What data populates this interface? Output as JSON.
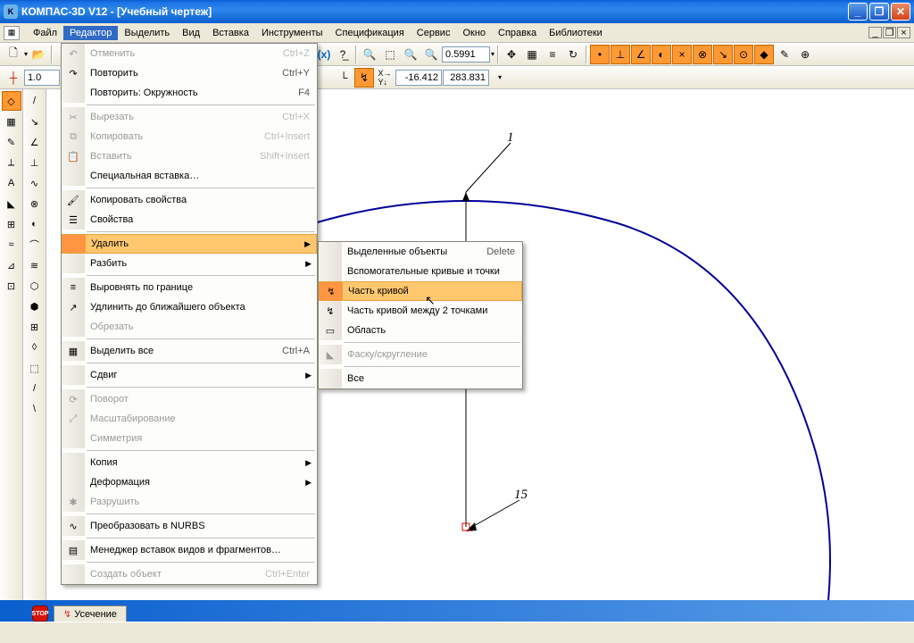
{
  "title": "КОМПАС-3D V12 - [Учебный чертеж]",
  "menubar": [
    "Файл",
    "Редактор",
    "Выделить",
    "Вид",
    "Вставка",
    "Инструменты",
    "Спецификация",
    "Сервис",
    "Окно",
    "Справка",
    "Библиотеки"
  ],
  "active_menu_index": 1,
  "toolbar2_value": "1.0",
  "zoom_value": "0.5991",
  "coord_x": "-16.412",
  "coord_y": "283.831",
  "editor_menu": [
    {
      "t": "item",
      "label": "Отменить",
      "shortcut": "Ctrl+Z",
      "disabled": true,
      "icon": "↶"
    },
    {
      "t": "item",
      "label": "Повторить",
      "shortcut": "Ctrl+Y",
      "icon": "↷"
    },
    {
      "t": "item",
      "label": "Повторить: Окружность",
      "shortcut": "F4"
    },
    {
      "t": "sep"
    },
    {
      "t": "item",
      "label": "Вырезать",
      "shortcut": "Ctrl+X",
      "disabled": true,
      "icon": "✂"
    },
    {
      "t": "item",
      "label": "Копировать",
      "shortcut": "Ctrl+Insert",
      "disabled": true,
      "icon": "⧉"
    },
    {
      "t": "item",
      "label": "Вставить",
      "shortcut": "Shift+Insert",
      "disabled": true,
      "icon": "📋"
    },
    {
      "t": "item",
      "label": "Специальная вставка…"
    },
    {
      "t": "sep"
    },
    {
      "t": "item",
      "label": "Копировать свойства",
      "icon": "🖌"
    },
    {
      "t": "item",
      "label": "Свойства",
      "icon": "☰"
    },
    {
      "t": "sep"
    },
    {
      "t": "item",
      "label": "Удалить",
      "submenu": true,
      "hover": true
    },
    {
      "t": "item",
      "label": "Разбить",
      "submenu": true
    },
    {
      "t": "sep"
    },
    {
      "t": "item",
      "label": "Выровнять по границе",
      "icon": "≡"
    },
    {
      "t": "item",
      "label": "Удлинить до ближайшего объекта",
      "icon": "↗"
    },
    {
      "t": "item",
      "label": "Обрезать",
      "disabled": true
    },
    {
      "t": "sep"
    },
    {
      "t": "item",
      "label": "Выделить все",
      "shortcut": "Ctrl+A",
      "icon": "▦"
    },
    {
      "t": "sep"
    },
    {
      "t": "item",
      "label": "Сдвиг",
      "submenu": true
    },
    {
      "t": "sep"
    },
    {
      "t": "item",
      "label": "Поворот",
      "disabled": true,
      "icon": "⟳"
    },
    {
      "t": "item",
      "label": "Масштабирование",
      "disabled": true,
      "icon": "⤢"
    },
    {
      "t": "item",
      "label": "Симметрия",
      "disabled": true
    },
    {
      "t": "sep"
    },
    {
      "t": "item",
      "label": "Копия",
      "submenu": true
    },
    {
      "t": "item",
      "label": "Деформация",
      "submenu": true
    },
    {
      "t": "item",
      "label": "Разрушить",
      "disabled": true,
      "icon": "✱"
    },
    {
      "t": "sep"
    },
    {
      "t": "item",
      "label": "Преобразовать в NURBS",
      "icon": "∿"
    },
    {
      "t": "sep"
    },
    {
      "t": "item",
      "label": "Менеджер вставок видов и фрагментов…",
      "icon": "▤"
    },
    {
      "t": "sep"
    },
    {
      "t": "item",
      "label": "Создать объект",
      "shortcut": "Ctrl+Enter",
      "disabled": true
    }
  ],
  "delete_submenu": [
    {
      "label": "Выделенные объекты",
      "shortcut": "Delete"
    },
    {
      "label": "Вспомогательные кривые и точки"
    },
    {
      "label": "Часть кривой",
      "hover": true,
      "icon": "↯"
    },
    {
      "label": "Часть кривой между 2 точками",
      "icon": "↯"
    },
    {
      "label": "Область",
      "icon": "▭"
    },
    {
      "t": "sep"
    },
    {
      "label": "Фаску/скругление",
      "disabled": true,
      "icon": "◣"
    },
    {
      "t": "sep"
    },
    {
      "label": "Все"
    }
  ],
  "tab_label": "Усечение",
  "leader1": "1",
  "leader2": "15"
}
